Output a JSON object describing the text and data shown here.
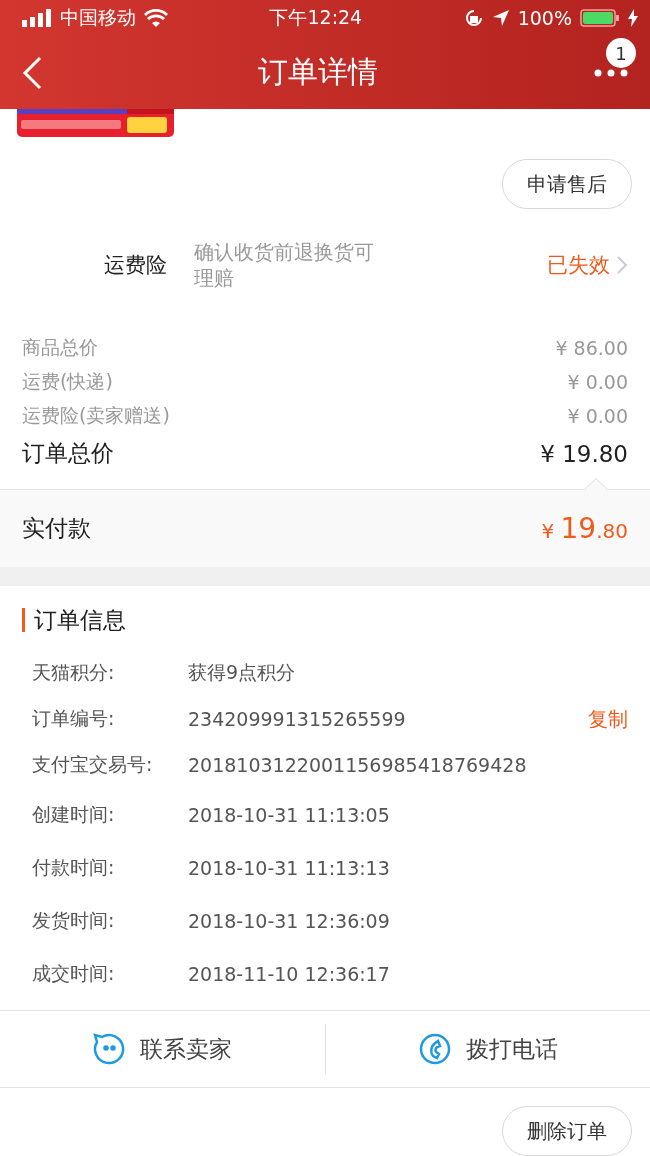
{
  "status_bar": {
    "carrier": "中国移动",
    "time": "下午12:24",
    "battery": "100%"
  },
  "nav": {
    "title": "订单详情",
    "badge": "1"
  },
  "after_sale_button": "申请售后",
  "insurance": {
    "label": "运费险",
    "description": "确认收货前退换货可理赔",
    "status": "已失效"
  },
  "price_rows": [
    {
      "label": "商品总价",
      "value": "¥ 86.00",
      "kind": "minor"
    },
    {
      "label": "运费(快递)",
      "value": "¥ 0.00",
      "kind": "minor"
    },
    {
      "label": "运费险(卖家赠送)",
      "value": "¥ 0.00",
      "kind": "minor"
    },
    {
      "label": "订单总价",
      "value": "¥ 19.80",
      "kind": "total"
    }
  ],
  "paid": {
    "label": "实付款",
    "currency": "¥",
    "integer": "19",
    "decimal": ".80"
  },
  "order_info": {
    "title": "订单信息",
    "rows": [
      {
        "label": "天猫积分:",
        "value": "获得9点积分"
      },
      {
        "label": "订单编号:",
        "value": "234209991315265599",
        "action": "复制"
      },
      {
        "label": "支付宝交易号:",
        "value": "2018103122001156985418769428"
      },
      {
        "label": "创建时间:",
        "value": "2018-10-31 11:13:05"
      },
      {
        "label": "付款时间:",
        "value": "2018-10-31 11:13:13"
      },
      {
        "label": "发货时间:",
        "value": "2018-10-31 12:36:09"
      },
      {
        "label": "成交时间:",
        "value": "2018-11-10 12:36:17"
      }
    ]
  },
  "footer_actions": [
    {
      "label": "联系卖家",
      "kind": "chat"
    },
    {
      "label": "拨打电话",
      "kind": "phone"
    }
  ],
  "delete_button": "删除订单"
}
